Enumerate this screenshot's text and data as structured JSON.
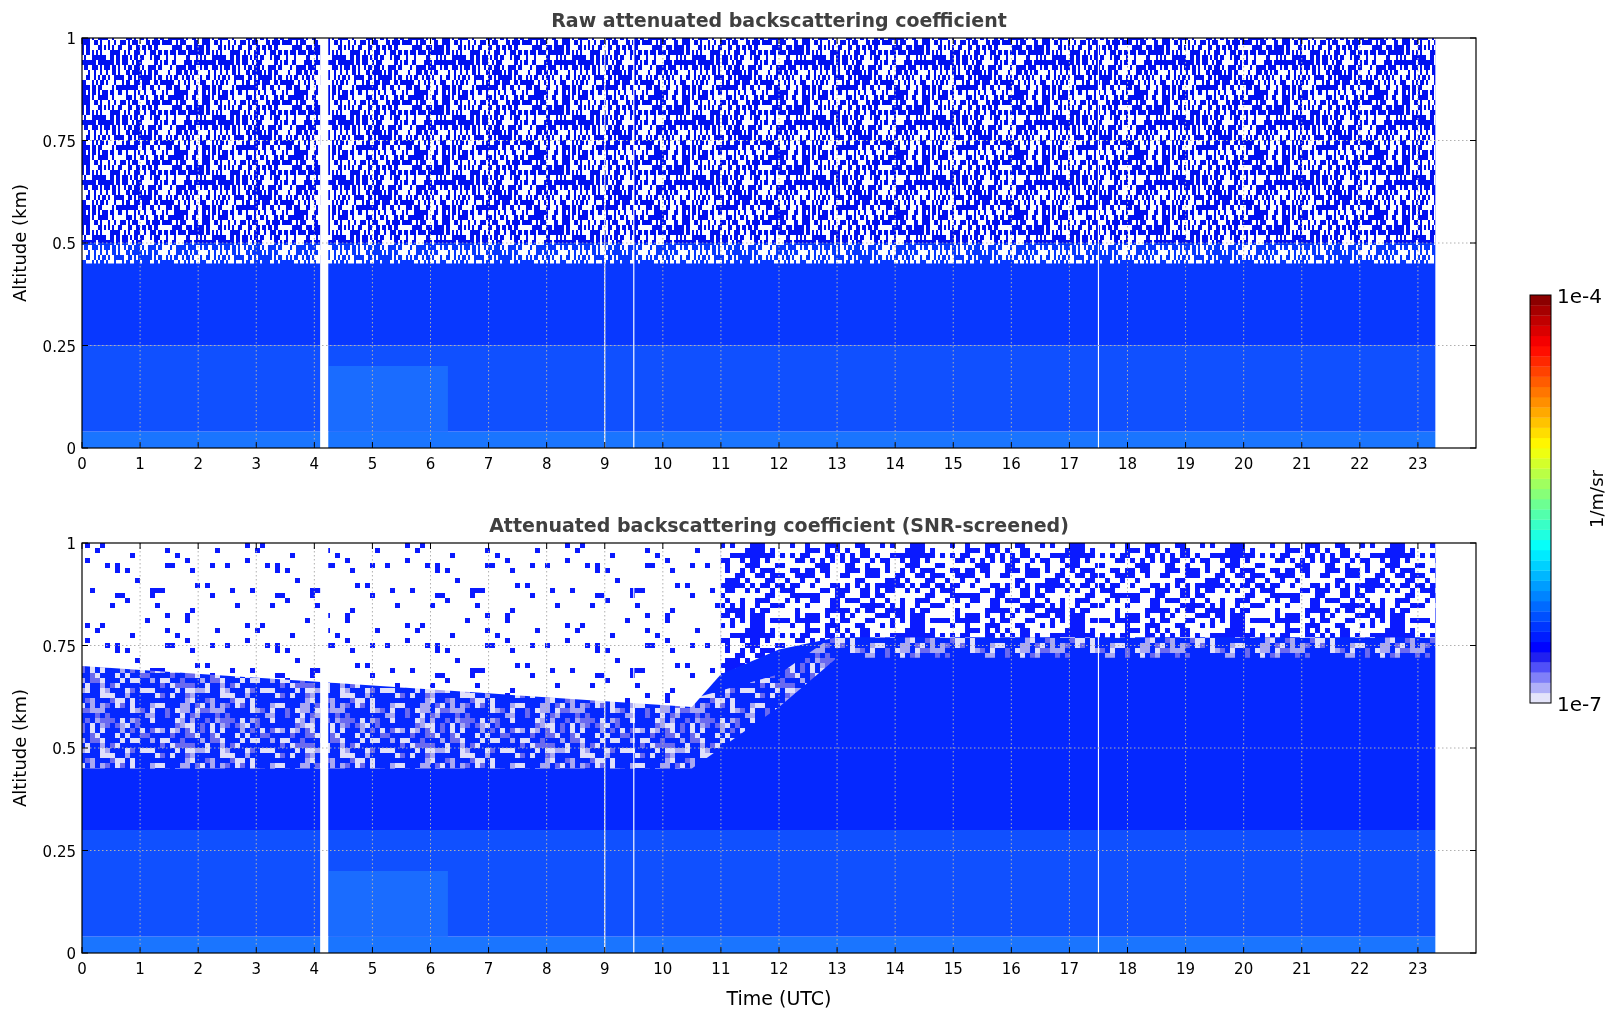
{
  "panels": [
    {
      "kind": "raw",
      "title": "Raw attenuated backscattering coefficient",
      "ylabel": "Altitude (km)",
      "yticks": [
        "1",
        "0.75",
        "0.5",
        "0.25",
        "0"
      ],
      "xticks": [
        "0",
        "1",
        "2",
        "3",
        "4",
        "5",
        "6",
        "7",
        "8",
        "9",
        "10",
        "11",
        "12",
        "13",
        "14",
        "15",
        "16",
        "17",
        "18",
        "19",
        "20",
        "21",
        "22",
        "23"
      ]
    },
    {
      "kind": "screened",
      "title": "Attenuated backscattering coefficient (SNR-screened)",
      "ylabel": "Altitude (km)",
      "yticks": [
        "1",
        "0.75",
        "0.5",
        "0.25",
        "0"
      ],
      "xticks": [
        "0",
        "1",
        "2",
        "3",
        "4",
        "5",
        "6",
        "7",
        "8",
        "9",
        "10",
        "11",
        "12",
        "13",
        "14",
        "15",
        "16",
        "17",
        "18",
        "19",
        "20",
        "21",
        "22",
        "23"
      ],
      "xlabel": "Time (UTC)"
    }
  ],
  "colorbar": {
    "max": "1e-4",
    "min": "1e-7",
    "label": "1/m/sr"
  }
}
